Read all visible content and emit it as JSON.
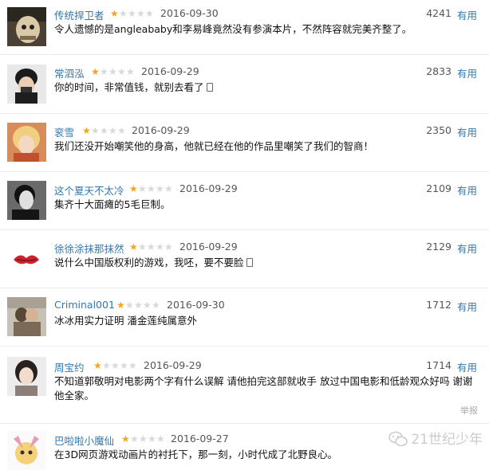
{
  "reviews": [
    {
      "user": "传统捍卫者",
      "stars": 1,
      "date": "2016-09-30",
      "votes": "4241",
      "useful": "有用",
      "text": "令人遗憾的是angleababy和李易峰竟然没有参演本片，不然阵容就完美齐整了。",
      "mobile": false
    },
    {
      "user": "常泗泓",
      "stars": 1,
      "date": "2016-09-29",
      "votes": "2833",
      "useful": "有用",
      "text": "你的时间，非常值钱，就别去看了",
      "mobile": true
    },
    {
      "user": "衮雪",
      "stars": 1,
      "date": "2016-09-29",
      "votes": "2350",
      "useful": "有用",
      "text": "我们还没开始嘲笑他的身高，他就已经在他的作品里嘲笑了我们的智商！",
      "mobile": false
    },
    {
      "user": "这个夏天不太冷",
      "stars": 1,
      "date": "2016-09-29",
      "votes": "2109",
      "useful": "有用",
      "text": "集齐十大面瘫的5毛巨制。",
      "mobile": false
    },
    {
      "user": "徐徐涂抹那抹然",
      "stars": 1,
      "date": "2016-09-29",
      "votes": "2129",
      "useful": "有用",
      "text": "说什么中国版权利的游戏，我呸，要不要脸",
      "mobile": true
    },
    {
      "user": "Criminal001",
      "stars": 1,
      "date": "2016-09-30",
      "votes": "1712",
      "useful": "有用",
      "text": "冰冰用实力证明 潘金莲纯属意外",
      "mobile": false
    },
    {
      "user": "周宝约",
      "stars": 1,
      "date": "2016-09-29",
      "votes": "1714",
      "useful": "有用",
      "text": "不知道郭敬明对电影两个字有什么误解 请他拍完这部就收手 放过中国电影和低龄观众好吗 谢谢他全家。",
      "mobile": false
    },
    {
      "user": "巴啦啦小魔仙",
      "stars": 1,
      "date": "2016-09-27",
      "votes": "",
      "useful": "",
      "text": "在3D网页游戏动画片的衬托下，那一刻，小时代成了北野良心。",
      "mobile": false
    }
  ],
  "report_label": "举报",
  "watermark": "21世纪少年",
  "colors": {
    "link": "#3377aa",
    "star_on": "#f7a41c",
    "star_off": "#d8d8d8"
  }
}
